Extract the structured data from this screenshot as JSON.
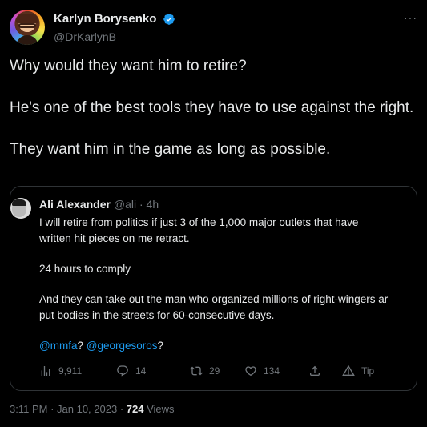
{
  "author": {
    "display_name": "Karlyn Borysenko",
    "handle": "@DrKarlynB",
    "more_label": "···"
  },
  "tweet": {
    "paragraphs": [
      "Why would they want him to retire?",
      "He's one of the best tools they have to use against the right.",
      "They want him in the game as long as possible."
    ]
  },
  "quoted": {
    "display_name": "Ali Alexander",
    "handle": "@ali",
    "separator": "·",
    "time": "4h",
    "line1": "I will retire from politics   if   just 3 of the 1,000 major outlets that have",
    "line2": "written hit pieces on me retract.",
    "line3": "24 hours to comply",
    "line4": "And they can take out the man who organized millions of right-wingers ar",
    "line5": "put bodies in the streets for 60-consecutive days.",
    "mention1": "@mmfa",
    "mention_sep": "? ",
    "mention2": "@georgesoros",
    "mention_end": "?",
    "stats": {
      "views": "9,911",
      "replies": "14",
      "retweets": "29",
      "likes": "134",
      "tip": "Tip"
    }
  },
  "footer": {
    "time": "3:11 PM",
    "sep1": " · ",
    "date": "Jan 10, 2023",
    "sep2": " · ",
    "views_count": "724",
    "views_label": " Views"
  },
  "colors": {
    "background": "#000000",
    "text": "#e7e9ea",
    "muted": "#71767b",
    "link": "#1d9bf0",
    "border": "#2f3336",
    "verified": "#1d9bf0"
  }
}
